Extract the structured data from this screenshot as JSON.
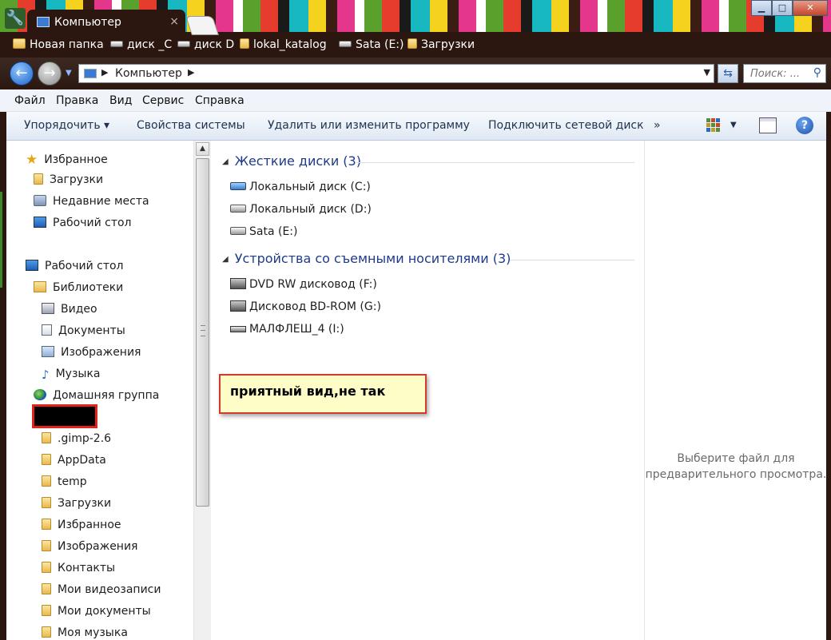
{
  "window": {
    "tab_title": "Компьютер",
    "tab_close": "×",
    "controls": {
      "minimize": "▁",
      "maximize": "□",
      "close": "✕"
    }
  },
  "bookmarks": [
    {
      "label": "Новая папка",
      "icon": "folder-icon"
    },
    {
      "label": "диск _C",
      "icon": "drive-icon"
    },
    {
      "label": "диск D",
      "icon": "drive-icon"
    },
    {
      "label": "lokal_katalog",
      "icon": "folder-icon"
    },
    {
      "label": "Sata (E:)",
      "icon": "drive-icon"
    },
    {
      "label": "Загрузки",
      "icon": "downloads-folder-icon"
    }
  ],
  "address": {
    "crumb": "Компьютер",
    "search_placeholder": "Поиск: ..."
  },
  "menu": [
    "Файл",
    "Правка",
    "Вид",
    "Сервис",
    "Справка"
  ],
  "commands": {
    "organize": "Упорядочить ▾",
    "system_properties": "Свойства системы",
    "uninstall": "Удалить или изменить программу",
    "map_drive": "Подключить сетевой диск",
    "more": "»"
  },
  "nav": {
    "favorites": "Избранное",
    "fav_items": [
      "Загрузки",
      "Недавние места",
      "Рабочий стол"
    ],
    "desktop": "Рабочий стол",
    "libraries": "Библиотеки",
    "lib_items": [
      "Видео",
      "Документы",
      "Изображения",
      "Музыка"
    ],
    "homegroup": "Домашняя группа",
    "user_folders": [
      ".gimp-2.6",
      "AppData",
      "temp",
      "Загрузки",
      "Избранное",
      "Изображения",
      "Контакты",
      "Мои видеозаписи",
      "Мои документы",
      "Моя музыка"
    ]
  },
  "content": {
    "hdd_group": "Жесткие диски (3)",
    "hdd_items": [
      "Локальный диск (C:)",
      "Локальный диск (D:)",
      "Sata (E:)"
    ],
    "removable_group": "Устройства со съемными носителями (3)",
    "removable_items": [
      "DVD RW дисковод (F:)",
      "Дисковод BD-ROM (G:)",
      "МАЛФЛЕШ_4 (I:)"
    ],
    "note": "приятный вид,не так"
  },
  "preview": {
    "line1": "Выберите файл для",
    "line2": "предварительного просмотра."
  }
}
